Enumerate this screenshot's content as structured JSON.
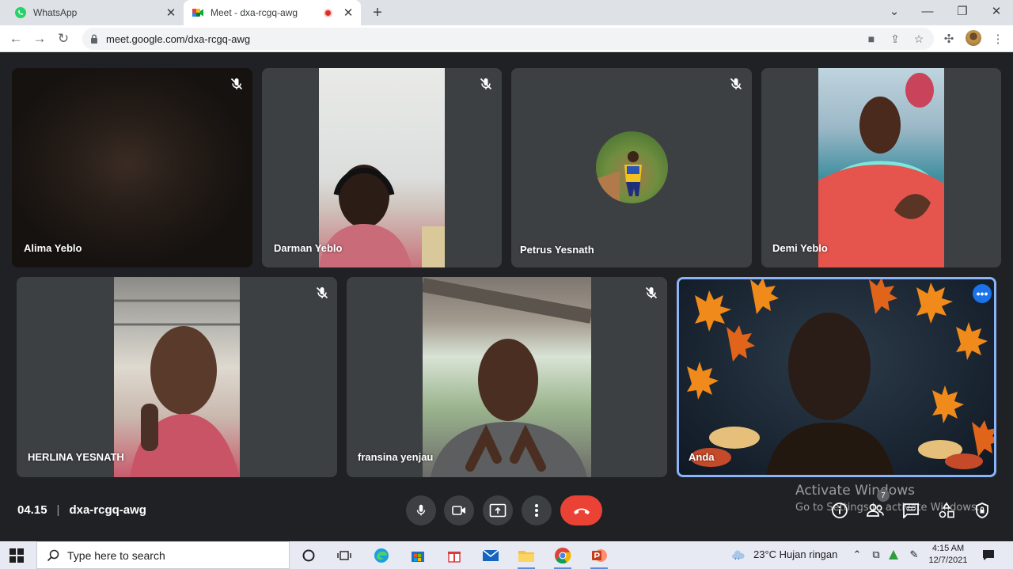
{
  "browser": {
    "tabs": [
      {
        "title": "WhatsApp",
        "favicon": "whatsapp-icon"
      },
      {
        "title": "Meet - dxa-rcgq-awg",
        "favicon": "google-meet-icon",
        "recording": true
      }
    ],
    "url": "meet.google.com/dxa-rcgq-awg"
  },
  "participants": [
    {
      "name": "Alima Yeblo",
      "muted": true
    },
    {
      "name": "Darman Yeblo",
      "muted": true
    },
    {
      "name": "Petrus Yesnath",
      "muted": true
    },
    {
      "name": "Demi Yeblo",
      "muted": false
    },
    {
      "name": "HERLINA YESNATH",
      "muted": true
    },
    {
      "name": "fransina yenjau",
      "muted": true
    },
    {
      "name": "Anda",
      "muted": false
    }
  ],
  "meeting": {
    "time": "04.15",
    "separator": "|",
    "code": "dxa-rcgq-awg",
    "participant_count": "7"
  },
  "watermark": {
    "line1": "Activate Windows",
    "line2": "Go to Settings to activate Windows."
  },
  "taskbar": {
    "search_placeholder": "Type here to search",
    "weather": "23°C  Hujan ringan",
    "time": "4:15 AM",
    "date": "12/7/2021"
  },
  "colors": {
    "meet_bg": "#202124",
    "tile_bg": "#3c4043",
    "hangup": "#ea4335",
    "active_speaker_border": "#8ab4f8"
  }
}
